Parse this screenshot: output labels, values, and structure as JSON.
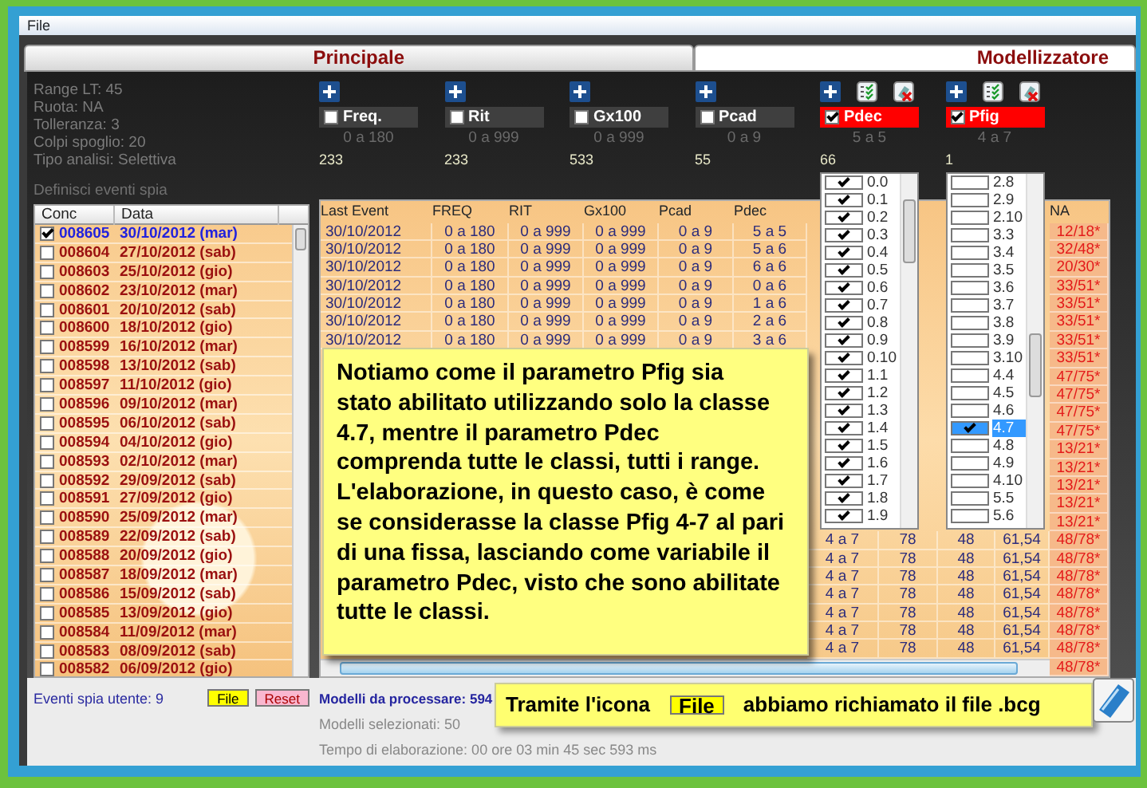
{
  "menu": [
    "File"
  ],
  "tabs": [
    {
      "label": "Principale",
      "selected": false
    },
    {
      "label": "Modellizzatore",
      "selected": true
    }
  ],
  "info": [
    "Range LT: 45",
    "Ruota: NA",
    "Tolleranza: 3",
    "Colpi spoglio: 20",
    "Tipo analisi: Selettiva"
  ],
  "parameters": [
    {
      "label": "Freq.",
      "checked": false,
      "class_tools": false,
      "range": "0 a 180",
      "count": "233"
    },
    {
      "label": "Rit",
      "checked": false,
      "class_tools": false,
      "range": "0 a 999",
      "count": "233"
    },
    {
      "label": "Gx100",
      "checked": false,
      "class_tools": false,
      "range": "0 a 999",
      "count": "533"
    },
    {
      "label": "Pcad",
      "checked": false,
      "class_tools": false,
      "range": "0 a 9",
      "count": "55"
    },
    {
      "label": "Pdec",
      "checked": true,
      "class_tools": true,
      "range": "5 a 5",
      "count": "66"
    },
    {
      "label": "Pfig",
      "checked": true,
      "class_tools": true,
      "range": "4 a 7",
      "count": "1"
    }
  ],
  "class_lists": [
    {
      "items": [
        {
          "label": "0.0",
          "checked": true,
          "selected": false
        },
        {
          "label": "0.1",
          "checked": true,
          "selected": false
        },
        {
          "label": "0.2",
          "checked": true,
          "selected": false
        },
        {
          "label": "0.3",
          "checked": true,
          "selected": false
        },
        {
          "label": "0.4",
          "checked": true,
          "selected": false
        },
        {
          "label": "0.5",
          "checked": true,
          "selected": false
        },
        {
          "label": "0.6",
          "checked": true,
          "selected": false
        },
        {
          "label": "0.7",
          "checked": true,
          "selected": false
        },
        {
          "label": "0.8",
          "checked": true,
          "selected": false
        },
        {
          "label": "0.9",
          "checked": true,
          "selected": false
        },
        {
          "label": "0.10",
          "checked": true,
          "selected": false
        },
        {
          "label": "1.1",
          "checked": true,
          "selected": false
        },
        {
          "label": "1.2",
          "checked": true,
          "selected": false
        },
        {
          "label": "1.3",
          "checked": true,
          "selected": false
        },
        {
          "label": "1.4",
          "checked": true,
          "selected": false
        },
        {
          "label": "1.5",
          "checked": true,
          "selected": false
        },
        {
          "label": "1.6",
          "checked": true,
          "selected": false
        },
        {
          "label": "1.7",
          "checked": true,
          "selected": false
        },
        {
          "label": "1.8",
          "checked": true,
          "selected": false
        },
        {
          "label": "1.9",
          "checked": true,
          "selected": false
        }
      ]
    },
    {
      "items": [
        {
          "label": "2.8",
          "checked": false,
          "selected": false
        },
        {
          "label": "2.9",
          "checked": false,
          "selected": false
        },
        {
          "label": "2.10",
          "checked": false,
          "selected": false
        },
        {
          "label": "3.3",
          "checked": false,
          "selected": false
        },
        {
          "label": "3.4",
          "checked": false,
          "selected": false
        },
        {
          "label": "3.5",
          "checked": false,
          "selected": false
        },
        {
          "label": "3.6",
          "checked": false,
          "selected": false
        },
        {
          "label": "3.7",
          "checked": false,
          "selected": false
        },
        {
          "label": "3.8",
          "checked": false,
          "selected": false
        },
        {
          "label": "3.9",
          "checked": false,
          "selected": false
        },
        {
          "label": "3.10",
          "checked": false,
          "selected": false
        },
        {
          "label": "4.4",
          "checked": false,
          "selected": false
        },
        {
          "label": "4.5",
          "checked": false,
          "selected": false
        },
        {
          "label": "4.6",
          "checked": false,
          "selected": false
        },
        {
          "label": "4.7",
          "checked": true,
          "selected": true
        },
        {
          "label": "4.8",
          "checked": false,
          "selected": false
        },
        {
          "label": "4.9",
          "checked": false,
          "selected": false
        },
        {
          "label": "4.10",
          "checked": false,
          "selected": false
        },
        {
          "label": "5.5",
          "checked": false,
          "selected": false
        },
        {
          "label": "5.6",
          "checked": false,
          "selected": false
        }
      ]
    }
  ],
  "spy_events": {
    "title": "Definisci eventi spia",
    "columns": [
      "Conc",
      "Data"
    ],
    "rows": [
      {
        "conc": "008605",
        "date": "30/10/2012 (mar)",
        "checked": true
      },
      {
        "conc": "008604",
        "date": "27/10/2012 (sab)",
        "checked": false
      },
      {
        "conc": "008603",
        "date": "25/10/2012 (gio)",
        "checked": false
      },
      {
        "conc": "008602",
        "date": "23/10/2012 (mar)",
        "checked": false
      },
      {
        "conc": "008601",
        "date": "20/10/2012 (sab)",
        "checked": false
      },
      {
        "conc": "008600",
        "date": "18/10/2012 (gio)",
        "checked": false
      },
      {
        "conc": "008599",
        "date": "16/10/2012 (mar)",
        "checked": false
      },
      {
        "conc": "008598",
        "date": "13/10/2012 (sab)",
        "checked": false
      },
      {
        "conc": "008597",
        "date": "11/10/2012 (gio)",
        "checked": false
      },
      {
        "conc": "008596",
        "date": "09/10/2012 (mar)",
        "checked": false
      },
      {
        "conc": "008595",
        "date": "06/10/2012 (sab)",
        "checked": false
      },
      {
        "conc": "008594",
        "date": "04/10/2012 (gio)",
        "checked": false
      },
      {
        "conc": "008593",
        "date": "02/10/2012 (mar)",
        "checked": false
      },
      {
        "conc": "008592",
        "date": "29/09/2012 (sab)",
        "checked": false
      },
      {
        "conc": "008591",
        "date": "27/09/2012 (gio)",
        "checked": false
      },
      {
        "conc": "008590",
        "date": "25/09/2012 (mar)",
        "checked": false
      },
      {
        "conc": "008589",
        "date": "22/09/2012 (sab)",
        "checked": false
      },
      {
        "conc": "008588",
        "date": "20/09/2012 (gio)",
        "checked": false
      },
      {
        "conc": "008587",
        "date": "18/09/2012 (mar)",
        "checked": false
      },
      {
        "conc": "008586",
        "date": "15/09/2012 (sab)",
        "checked": false
      },
      {
        "conc": "008585",
        "date": "13/09/2012 (gio)",
        "checked": false
      },
      {
        "conc": "008584",
        "date": "11/09/2012 (mar)",
        "checked": false
      },
      {
        "conc": "008583",
        "date": "08/09/2012 (sab)",
        "checked": false
      },
      {
        "conc": "008582",
        "date": "06/09/2012 (gio)",
        "checked": false
      }
    ]
  },
  "models_table": {
    "columns": [
      "Last Event",
      "FREQ",
      "RIT",
      "Gx100",
      "Pcad",
      "Pdec"
    ],
    "top_rows": [
      [
        "30/10/2012",
        "0 a 180",
        "0 a 999",
        "0 a 999",
        "0 a 9",
        "5 a 5"
      ],
      [
        "30/10/2012",
        "0 a 180",
        "0 a 999",
        "0 a 999",
        "0 a 9",
        "5 a 6"
      ],
      [
        "30/10/2012",
        "0 a 180",
        "0 a 999",
        "0 a 999",
        "0 a 9",
        "6 a 6"
      ],
      [
        "30/10/2012",
        "0 a 180",
        "0 a 999",
        "0 a 999",
        "0 a 9",
        "0 a 6"
      ],
      [
        "30/10/2012",
        "0 a 180",
        "0 a 999",
        "0 a 999",
        "0 a 9",
        "1 a 6"
      ],
      [
        "30/10/2012",
        "0 a 180",
        "0 a 999",
        "0 a 999",
        "0 a 9",
        "2 a 6"
      ],
      [
        "30/10/2012",
        "0 a 180",
        "0 a 999",
        "0 a 999",
        "0 a 9",
        "3 a 6"
      ]
    ],
    "lower_rows": [
      [
        "4 a 7",
        "78",
        "48",
        "61,54"
      ],
      [
        "4 a 7",
        "78",
        "48",
        "61,54"
      ],
      [
        "4 a 7",
        "78",
        "48",
        "61,54"
      ],
      [
        "4 a 7",
        "78",
        "48",
        "61,54"
      ],
      [
        "4 a 7",
        "78",
        "48",
        "61,54"
      ],
      [
        "4 a 7",
        "78",
        "48",
        "61,54"
      ],
      [
        "4 a 7",
        "78",
        "48",
        "61,54"
      ]
    ],
    "na_column": {
      "header": "NA",
      "values": [
        "12/18*",
        "32/48*",
        "20/30*",
        "33/51*",
        "33/51*",
        "33/51*",
        "33/51*",
        "33/51*",
        "47/75*",
        "47/75*",
        "47/75*",
        "47/75*",
        "13/21*",
        "13/21*",
        "13/21*",
        "13/21*",
        "13/21*",
        "48/78*",
        "48/78*",
        "48/78*",
        "48/78*",
        "48/78*",
        "48/78*",
        "48/78*",
        "48/78*"
      ]
    }
  },
  "note": "Notiamo come il parametro Pfig sia stato abilitato utilizzando solo la classe 4.7, mentre il parametro Pdec comprenda tutte le classi, tutti i range. L'elaborazione, in questo caso, è come se considerasse la classe Pfig 4-7 al pari di una fissa, lasciando come variabile il parametro Pdec, visto che sono abilitate tutte le classi.",
  "footer": {
    "user_events": "Eventi spia utente: 9",
    "buttons": [
      {
        "label": "File",
        "kind": "file"
      },
      {
        "label": "Reset",
        "kind": "reset"
      }
    ],
    "to_process": "Modelli da processare: 594",
    "selected_models": "Modelli selezionati: 50",
    "elapsed": "Tempo di elaborazione: 00 ore 03 min 45 sec 593 ms"
  },
  "callout": {
    "before": "Tramite l'icona",
    "button": "File",
    "after": "abbiamo richiamato il file .bcg"
  }
}
